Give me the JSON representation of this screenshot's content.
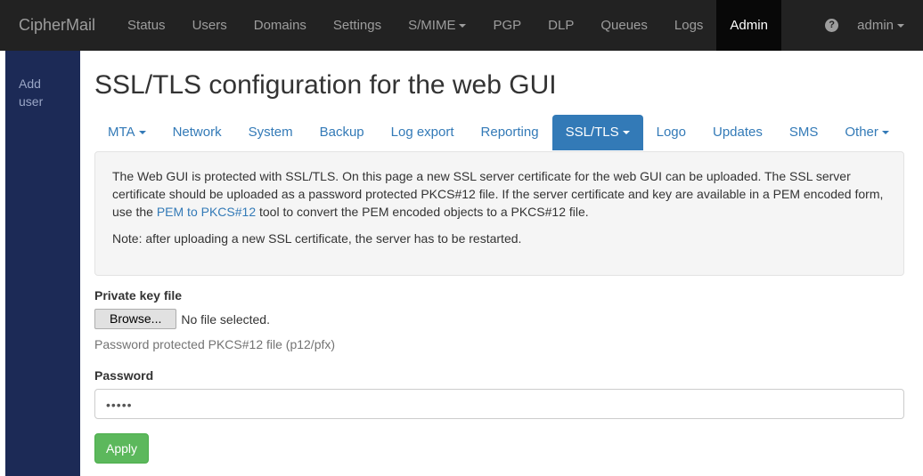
{
  "navbar": {
    "brand": "CipherMail",
    "items": [
      {
        "label": "Status"
      },
      {
        "label": "Users"
      },
      {
        "label": "Domains"
      },
      {
        "label": "Settings"
      },
      {
        "label": "S/MIME"
      },
      {
        "label": "PGP"
      },
      {
        "label": "DLP"
      },
      {
        "label": "Queues"
      },
      {
        "label": "Logs"
      },
      {
        "label": "Admin"
      }
    ],
    "help_glyph": "?",
    "user": "admin"
  },
  "sidebar": {
    "items": [
      {
        "label": "Add user"
      }
    ]
  },
  "main": {
    "title": "SSL/TLS configuration for the web GUI",
    "tabs": [
      {
        "label": "MTA"
      },
      {
        "label": "Network"
      },
      {
        "label": "System"
      },
      {
        "label": "Backup"
      },
      {
        "label": "Log export"
      },
      {
        "label": "Reporting"
      },
      {
        "label": "SSL/TLS"
      },
      {
        "label": "Logo"
      },
      {
        "label": "Updates"
      },
      {
        "label": "SMS"
      },
      {
        "label": "Other"
      }
    ],
    "info": {
      "p1_before": "The Web GUI is protected with SSL/TLS. On this page a new SSL server certificate for the web GUI can be uploaded. The SSL server certificate should be uploaded as a password protected PKCS#12 file. If the server certificate and key are available in a PEM encoded form, use the ",
      "p1_link": "PEM to PKCS#12",
      "p1_after": " tool to convert the PEM encoded objects to a PKCS#12 file.",
      "p2": "Note: after uploading a new SSL certificate, the server has to be restarted."
    },
    "form": {
      "key_label": "Private key file",
      "browse_label": "Browse...",
      "file_status": "No file selected.",
      "key_help": "Password protected PKCS#12 file (p12/pfx)",
      "password_label": "Password",
      "password_value": "•••••",
      "apply_label": "Apply"
    }
  },
  "colors": {
    "navbar_bg": "#222222",
    "sidebar_bg": "#1c2a56",
    "accent": "#337ab7",
    "apply": "#5cb85c"
  }
}
